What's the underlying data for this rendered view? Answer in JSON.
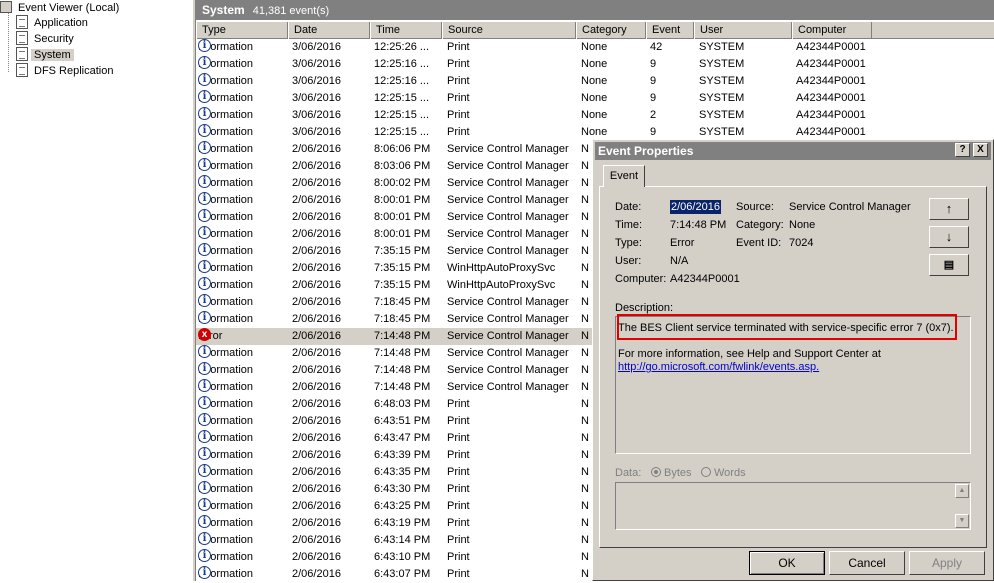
{
  "tree": {
    "root": "Event Viewer (Local)",
    "logs": [
      "Application",
      "Security",
      "System",
      "DFS Replication"
    ],
    "selected": "System"
  },
  "header": {
    "log_name": "System",
    "count": "41,381 event(s)"
  },
  "columns": [
    "Type",
    "Date",
    "Time",
    "Source",
    "Category",
    "Event",
    "User",
    "Computer"
  ],
  "rows": [
    [
      "Information",
      "3/06/2016",
      "12:25:26 ...",
      "Print",
      "None",
      "42",
      "SYSTEM",
      "A42344P0001"
    ],
    [
      "Information",
      "3/06/2016",
      "12:25:16 ...",
      "Print",
      "None",
      "9",
      "SYSTEM",
      "A42344P0001"
    ],
    [
      "Information",
      "3/06/2016",
      "12:25:16 ...",
      "Print",
      "None",
      "9",
      "SYSTEM",
      "A42344P0001"
    ],
    [
      "Information",
      "3/06/2016",
      "12:25:15 ...",
      "Print",
      "None",
      "9",
      "SYSTEM",
      "A42344P0001"
    ],
    [
      "Information",
      "3/06/2016",
      "12:25:15 ...",
      "Print",
      "None",
      "2",
      "SYSTEM",
      "A42344P0001"
    ],
    [
      "Information",
      "3/06/2016",
      "12:25:15 ...",
      "Print",
      "None",
      "9",
      "SYSTEM",
      "A42344P0001"
    ],
    [
      "Information",
      "2/06/2016",
      "8:06:06 PM",
      "Service Control Manager",
      "N",
      "",
      "",
      ""
    ],
    [
      "Information",
      "2/06/2016",
      "8:03:06 PM",
      "Service Control Manager",
      "N",
      "",
      "",
      ""
    ],
    [
      "Information",
      "2/06/2016",
      "8:00:02 PM",
      "Service Control Manager",
      "N",
      "",
      "",
      ""
    ],
    [
      "Information",
      "2/06/2016",
      "8:00:01 PM",
      "Service Control Manager",
      "N",
      "",
      "",
      ""
    ],
    [
      "Information",
      "2/06/2016",
      "8:00:01 PM",
      "Service Control Manager",
      "N",
      "",
      "",
      ""
    ],
    [
      "Information",
      "2/06/2016",
      "8:00:01 PM",
      "Service Control Manager",
      "N",
      "",
      "",
      ""
    ],
    [
      "Information",
      "2/06/2016",
      "7:35:15 PM",
      "Service Control Manager",
      "N",
      "",
      "",
      ""
    ],
    [
      "Information",
      "2/06/2016",
      "7:35:15 PM",
      "WinHttpAutoProxySvc",
      "N",
      "",
      "",
      ""
    ],
    [
      "Information",
      "2/06/2016",
      "7:35:15 PM",
      "WinHttpAutoProxySvc",
      "N",
      "",
      "",
      ""
    ],
    [
      "Information",
      "2/06/2016",
      "7:18:45 PM",
      "Service Control Manager",
      "N",
      "",
      "",
      ""
    ],
    [
      "Information",
      "2/06/2016",
      "7:18:45 PM",
      "Service Control Manager",
      "N",
      "",
      "",
      ""
    ],
    [
      "Error",
      "2/06/2016",
      "7:14:48 PM",
      "Service Control Manager",
      "N",
      "",
      "",
      ""
    ],
    [
      "Information",
      "2/06/2016",
      "7:14:48 PM",
      "Service Control Manager",
      "N",
      "",
      "",
      ""
    ],
    [
      "Information",
      "2/06/2016",
      "7:14:48 PM",
      "Service Control Manager",
      "N",
      "",
      "",
      ""
    ],
    [
      "Information",
      "2/06/2016",
      "7:14:48 PM",
      "Service Control Manager",
      "N",
      "",
      "",
      ""
    ],
    [
      "Information",
      "2/06/2016",
      "6:48:03 PM",
      "Print",
      "N",
      "",
      "",
      ""
    ],
    [
      "Information",
      "2/06/2016",
      "6:43:51 PM",
      "Print",
      "N",
      "",
      "",
      ""
    ],
    [
      "Information",
      "2/06/2016",
      "6:43:47 PM",
      "Print",
      "N",
      "",
      "",
      ""
    ],
    [
      "Information",
      "2/06/2016",
      "6:43:39 PM",
      "Print",
      "N",
      "",
      "",
      ""
    ],
    [
      "Information",
      "2/06/2016",
      "6:43:35 PM",
      "Print",
      "N",
      "",
      "",
      ""
    ],
    [
      "Information",
      "2/06/2016",
      "6:43:30 PM",
      "Print",
      "N",
      "",
      "",
      ""
    ],
    [
      "Information",
      "2/06/2016",
      "6:43:25 PM",
      "Print",
      "N",
      "",
      "",
      ""
    ],
    [
      "Information",
      "2/06/2016",
      "6:43:19 PM",
      "Print",
      "N",
      "",
      "",
      ""
    ],
    [
      "Information",
      "2/06/2016",
      "6:43:14 PM",
      "Print",
      "N",
      "",
      "",
      ""
    ],
    [
      "Information",
      "2/06/2016",
      "6:43:10 PM",
      "Print",
      "N",
      "",
      "",
      ""
    ],
    [
      "Information",
      "2/06/2016",
      "6:43:07 PM",
      "Print",
      "N",
      "",
      "",
      ""
    ]
  ],
  "selected_row": 17,
  "dialog": {
    "title": "Event Properties",
    "help_btn": "?",
    "close_btn": "X",
    "tab": "Event",
    "date_label": "Date:",
    "date": "2/06/2016",
    "source_label": "Source:",
    "source": "Service Control Manager",
    "time_label": "Time:",
    "time": "7:14:48 PM",
    "category_label": "Category:",
    "category": "None",
    "type_label": "Type:",
    "type": "Error",
    "event_id_label": "Event ID:",
    "event_id": "7024",
    "user_label": "User:",
    "user": "N/A",
    "computer_label": "Computer:",
    "computer": "A42344P0001",
    "description_label": "Description:",
    "description": "The BES Client service terminated with service-specific error 7 (0x7).",
    "more_info": "For more information, see Help and Support Center at",
    "link": "http://go.microsoft.com/fwlink/events.asp.",
    "data_label": "Data:",
    "bytes_label": "Bytes",
    "words_label": "Words",
    "ok": "OK",
    "cancel": "Cancel",
    "apply": "Apply"
  },
  "icons": {
    "info": "i",
    "error": "x",
    "up": "↑",
    "down": "↓",
    "copy": "▤"
  },
  "colors": {
    "highlight": "#e00000",
    "selection": "#0a246a"
  }
}
